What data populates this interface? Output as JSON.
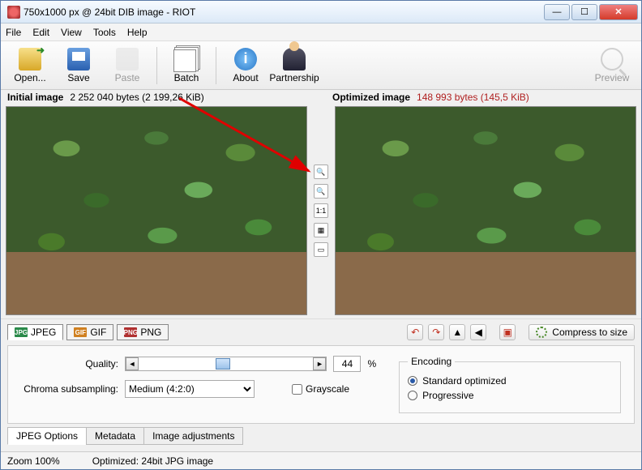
{
  "window": {
    "title": "750x1000 px @ 24bit  DIB image - RIOT"
  },
  "menu": {
    "file": "File",
    "edit": "Edit",
    "view": "View",
    "tools": "Tools",
    "help": "Help"
  },
  "toolbar": {
    "open": "Open...",
    "save": "Save",
    "paste": "Paste",
    "batch": "Batch",
    "about": "About",
    "partnership": "Partnership",
    "preview": "Preview"
  },
  "headers": {
    "initial_label": "Initial image",
    "initial_size": "2 252 040 bytes (2 199,26 KiB)",
    "optimized_label": "Optimized image",
    "optimized_size": "148 993 bytes (145,5 KiB)"
  },
  "midtools": {
    "zoom_in": "+",
    "zoom_out": "−",
    "one_to_one": "1:1",
    "fit": "▦",
    "screen": "▭"
  },
  "format_tabs": {
    "jpeg": "JPEG",
    "gif": "GIF",
    "png": "PNG"
  },
  "right_tools": {
    "rotate_ccw": "↶",
    "rotate_cw": "↷",
    "flip_h": "▲",
    "flip_v": "◀",
    "crop": "▣",
    "compress": "Compress to size"
  },
  "opts": {
    "quality_label": "Quality:",
    "quality_value": "44",
    "quality_pct": "%",
    "chroma_label": "Chroma subsampling:",
    "chroma_value": "Medium (4:2:0)",
    "grayscale": "Grayscale",
    "encoding_legend": "Encoding",
    "std": "Standard optimized",
    "prog": "Progressive"
  },
  "bottom_tabs": {
    "jpeg_options": "JPEG Options",
    "metadata": "Metadata",
    "image_adj": "Image adjustments"
  },
  "status": {
    "zoom": "Zoom 100%",
    "optimized": "Optimized: 24bit JPG image"
  }
}
